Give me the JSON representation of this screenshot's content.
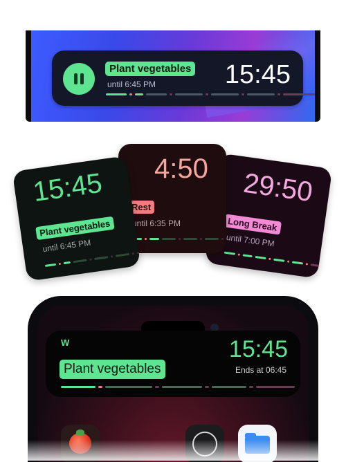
{
  "colors": {
    "accent_green": "#5de592",
    "rest_red": "#f07e80",
    "long_break_pink": "#f48ad6",
    "bar_dim": "#3a4a55"
  },
  "top_activity": {
    "task": "Plant vegetables",
    "until": "until 6:45 PM",
    "time": "15:45",
    "icon": "pause-icon",
    "progress": [
      {
        "w": 30,
        "c": "#5de592"
      },
      {
        "w": 4,
        "c": "#f07e80"
      },
      {
        "w": 12,
        "c": "#5de592"
      },
      {
        "w": 30,
        "c": "#4a5a68"
      },
      {
        "w": 4,
        "c": "#6b3c55"
      },
      {
        "w": 40,
        "c": "#4a5a68"
      },
      {
        "w": 4,
        "c": "#6b3c55"
      },
      {
        "w": 40,
        "c": "#4a5a68"
      },
      {
        "w": 4,
        "c": "#6b3c55"
      },
      {
        "w": 40,
        "c": "#4a5a68"
      },
      {
        "w": 4,
        "c": "#6b3c55"
      },
      {
        "w": 50,
        "c": "#6b3c55"
      }
    ]
  },
  "widgets": [
    {
      "time": "15:45",
      "label": "Plant vegetables",
      "until": "until 6:45 PM",
      "progress": [
        {
          "w": 16,
          "c": "#5de592"
        },
        {
          "w": 3,
          "c": "#f07e80"
        },
        {
          "w": 10,
          "c": "#5de592"
        },
        {
          "w": 20,
          "c": "#2e4a38"
        },
        {
          "w": 3,
          "c": "#4a2a35"
        },
        {
          "w": 20,
          "c": "#2e4a38"
        },
        {
          "w": 3,
          "c": "#4a2a35"
        },
        {
          "w": 20,
          "c": "#2e4a38"
        },
        {
          "w": 3,
          "c": "#4a2a35"
        },
        {
          "w": 20,
          "c": "#4a2a35"
        }
      ]
    },
    {
      "time": "4:50",
      "label": "Rest",
      "until": "until 6:35 PM",
      "progress": [
        {
          "w": 14,
          "c": "#5de592"
        },
        {
          "w": 3,
          "c": "#f07e80"
        },
        {
          "w": 14,
          "c": "#5de592"
        },
        {
          "w": 20,
          "c": "#2e4a38"
        },
        {
          "w": 3,
          "c": "#4a2a35"
        },
        {
          "w": 20,
          "c": "#2e4a38"
        },
        {
          "w": 3,
          "c": "#4a2a35"
        },
        {
          "w": 20,
          "c": "#2e4a38"
        },
        {
          "w": 3,
          "c": "#4a2a35"
        },
        {
          "w": 20,
          "c": "#4a2a35"
        }
      ]
    },
    {
      "time": "29:50",
      "label": "Long Break",
      "until": "until 7:00 PM",
      "progress": [
        {
          "w": 16,
          "c": "#5de592"
        },
        {
          "w": 3,
          "c": "#f07e80"
        },
        {
          "w": 14,
          "c": "#5de592"
        },
        {
          "w": 16,
          "c": "#5de592"
        },
        {
          "w": 3,
          "c": "#f07e80"
        },
        {
          "w": 16,
          "c": "#5de592"
        },
        {
          "w": 3,
          "c": "#f07e80"
        },
        {
          "w": 16,
          "c": "#5de592"
        },
        {
          "w": 3,
          "c": "#f07e80"
        },
        {
          "w": 20,
          "c": "#6b3c55"
        }
      ]
    }
  ],
  "bottom_activity": {
    "app_letter": "W",
    "task": "Plant vegetables",
    "time": "15:45",
    "ends": "Ends at 06:45",
    "progress": [
      {
        "w": 50,
        "c": "#5de592"
      },
      {
        "w": 6,
        "c": "#f07e80"
      },
      {
        "w": 68,
        "c": "#4a6a55"
      },
      {
        "w": 6,
        "c": "#6b3c55"
      },
      {
        "w": 58,
        "c": "#4a6a55"
      },
      {
        "w": 6,
        "c": "#6b3c55"
      },
      {
        "w": 50,
        "c": "#4a6a55"
      },
      {
        "w": 6,
        "c": "#6b3c55"
      },
      {
        "w": 56,
        "c": "#6b3c55"
      }
    ]
  },
  "dock_apps": [
    {
      "name": "tomato-app",
      "icon": "tomato-icon"
    },
    {
      "name": "clock-app",
      "icon": "clock-icon"
    },
    {
      "name": "files-app",
      "icon": "folder-icon"
    }
  ]
}
